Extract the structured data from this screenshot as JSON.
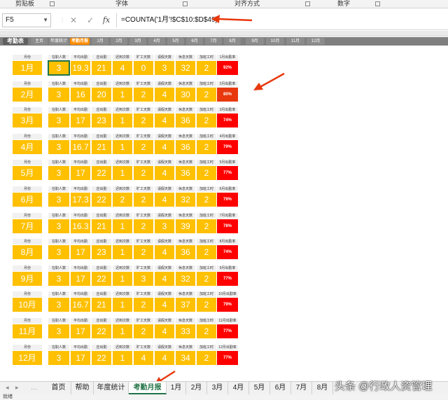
{
  "ribbon": {
    "groups": [
      {
        "label": "剪贴板"
      },
      {
        "label": "字体"
      },
      {
        "label": "对齐方式"
      },
      {
        "label": "数字"
      }
    ]
  },
  "formula_bar": {
    "name_box": "F5",
    "cancel_icon": "✕",
    "enter_icon": "✓",
    "fx_label": "fx",
    "formula": "=COUNTA('1月'!$C$10:$D$49)"
  },
  "sheet_nav": {
    "title": "考勤表",
    "items": [
      "主页",
      "年度统计",
      "考勤月报",
      "1月",
      "2月",
      "3月",
      "4月",
      "5月",
      "6月",
      "7月",
      "8月",
      "9月",
      "10月",
      "11月",
      "12月"
    ],
    "active": "考勤月报"
  },
  "headers": [
    "月份",
    "在职人数",
    "平均出勤",
    "应出勤",
    "迟到次数",
    "旷工天数",
    "请假天数",
    "休息天数",
    "加班工时"
  ],
  "months": [
    {
      "month": "1月",
      "values": [
        "3",
        "19.3",
        "21",
        "4",
        "0",
        "3",
        "32",
        "2"
      ],
      "rate_label": "1月出勤率",
      "rate": "92%"
    },
    {
      "month": "2月",
      "values": [
        "3",
        "16",
        "20",
        "1",
        "2",
        "4",
        "30",
        "2"
      ],
      "rate_label": "2月出勤率",
      "rate": "80%"
    },
    {
      "month": "3月",
      "values": [
        "3",
        "17",
        "23",
        "1",
        "2",
        "4",
        "36",
        "2"
      ],
      "rate_label": "3月出勤率",
      "rate": "74%"
    },
    {
      "month": "4月",
      "values": [
        "3",
        "16.7",
        "21",
        "1",
        "2",
        "4",
        "36",
        "2"
      ],
      "rate_label": "4月出勤率",
      "rate": "79%"
    },
    {
      "month": "5月",
      "values": [
        "3",
        "17",
        "22",
        "1",
        "2",
        "4",
        "36",
        "2"
      ],
      "rate_label": "5月出勤率",
      "rate": "77%"
    },
    {
      "month": "6月",
      "values": [
        "3",
        "17.3",
        "22",
        "2",
        "2",
        "4",
        "32",
        "2"
      ],
      "rate_label": "6月出勤率",
      "rate": "79%"
    },
    {
      "month": "7月",
      "values": [
        "3",
        "16.3",
        "21",
        "1",
        "2",
        "3",
        "39",
        "2"
      ],
      "rate_label": "7月出勤率",
      "rate": "78%"
    },
    {
      "month": "8月",
      "values": [
        "3",
        "17",
        "23",
        "1",
        "2",
        "4",
        "36",
        "2"
      ],
      "rate_label": "8月出勤率",
      "rate": "74%"
    },
    {
      "month": "9月",
      "values": [
        "3",
        "17",
        "22",
        "1",
        "3",
        "4",
        "32",
        "2"
      ],
      "rate_label": "9月出勤率",
      "rate": "77%"
    },
    {
      "month": "10月",
      "values": [
        "3",
        "16.7",
        "21",
        "1",
        "2",
        "4",
        "37",
        "2"
      ],
      "rate_label": "10月出勤率",
      "rate": "79%"
    },
    {
      "month": "11月",
      "values": [
        "3",
        "17",
        "22",
        "1",
        "2",
        "4",
        "33",
        "2"
      ],
      "rate_label": "11月出勤率",
      "rate": "77%"
    },
    {
      "month": "12月",
      "values": [
        "3",
        "17",
        "22",
        "1",
        "4",
        "4",
        "34",
        "2"
      ],
      "rate_label": "12月出勤率",
      "rate": "77%"
    }
  ],
  "sheet_tabs": {
    "items": [
      "首页",
      "帮助",
      "年度统计",
      "考勤月报",
      "1月",
      "2月",
      "3月",
      "4月",
      "5月",
      "6月",
      "7月",
      "8月"
    ],
    "active": "考勤月报"
  },
  "status_bar": "就绪",
  "watermark": "头条 @行政人资管理",
  "colors": {
    "cell": "#ffc000",
    "rate": "#ff0000",
    "active_tab": "#217346",
    "nav_active": "#ff8c00"
  }
}
